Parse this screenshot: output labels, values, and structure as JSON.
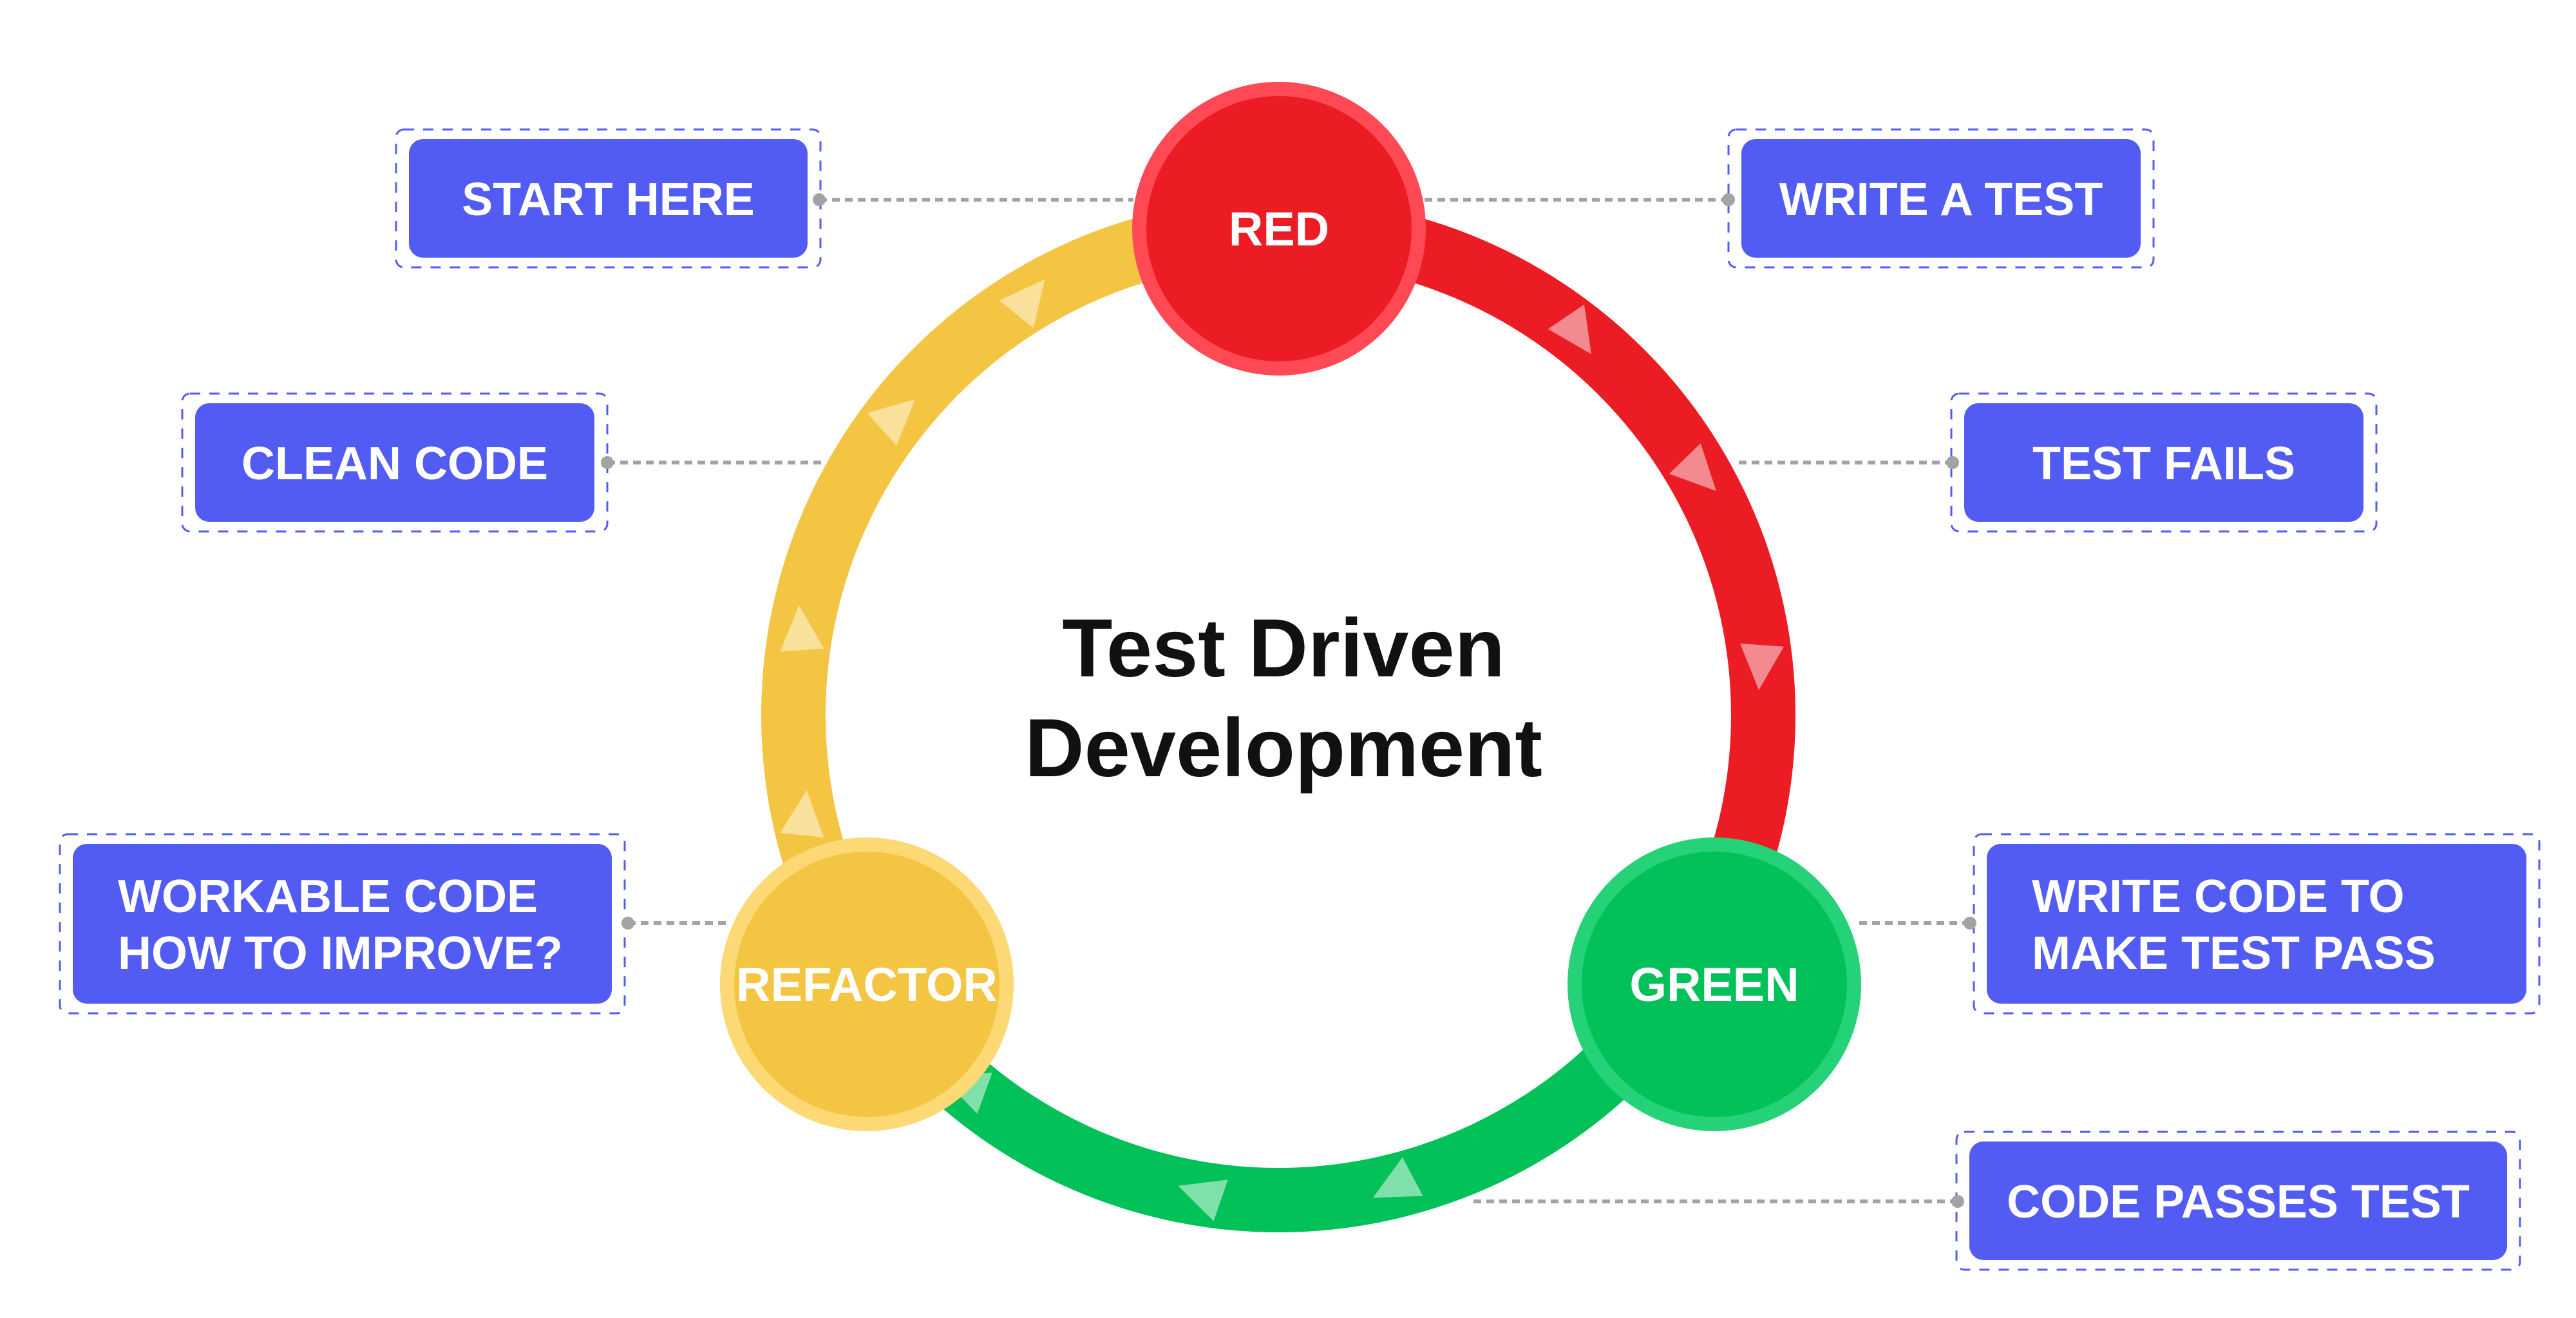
{
  "title": {
    "lines": [
      "Test Driven",
      "Development"
    ]
  },
  "colors": {
    "label_bg": "#525CF3",
    "label_border": "#525CF3",
    "label_text": "#FFFFFF",
    "connector": "#A3A3A3",
    "title": "#111111",
    "red": "#EC1C24",
    "red_ring": "#FF4A55",
    "red_arrow": "#F38A90",
    "green": "#02C158",
    "green_ring": "#26D277",
    "green_arrow": "#80E0A9",
    "yellow": "#F4C542",
    "yellow_ring": "#FCD975",
    "yellow_arrow": "#F9E19C"
  },
  "phases": [
    {
      "id": "red",
      "label": "RED",
      "color_key": "red",
      "arrow_count": 4,
      "direction": "clockwise"
    },
    {
      "id": "green",
      "label": "GREEN",
      "color_key": "green",
      "arrow_count": 4,
      "direction": "clockwise"
    },
    {
      "id": "refactor",
      "label": "REFACTOR",
      "color_key": "yellow",
      "arrow_count": 4,
      "direction": "clockwise"
    }
  ],
  "labels": [
    {
      "id": "start-here",
      "lines": [
        "START HERE"
      ],
      "attached_to": "red"
    },
    {
      "id": "write-a-test",
      "lines": [
        "WRITE A TEST"
      ],
      "attached_to": "red"
    },
    {
      "id": "clean-code",
      "lines": [
        "CLEAN CODE"
      ],
      "attached_to": "refactor-arc"
    },
    {
      "id": "test-fails",
      "lines": [
        "TEST FAILS"
      ],
      "attached_to": "red-arc"
    },
    {
      "id": "workable-code",
      "lines": [
        "WORKABLE CODE",
        "HOW TO IMPROVE?"
      ],
      "attached_to": "refactor"
    },
    {
      "id": "write-code",
      "lines": [
        "WRITE CODE TO",
        "MAKE TEST PASS"
      ],
      "attached_to": "green"
    },
    {
      "id": "code-passes",
      "lines": [
        "CODE PASSES TEST"
      ],
      "attached_to": "green-arc"
    }
  ]
}
